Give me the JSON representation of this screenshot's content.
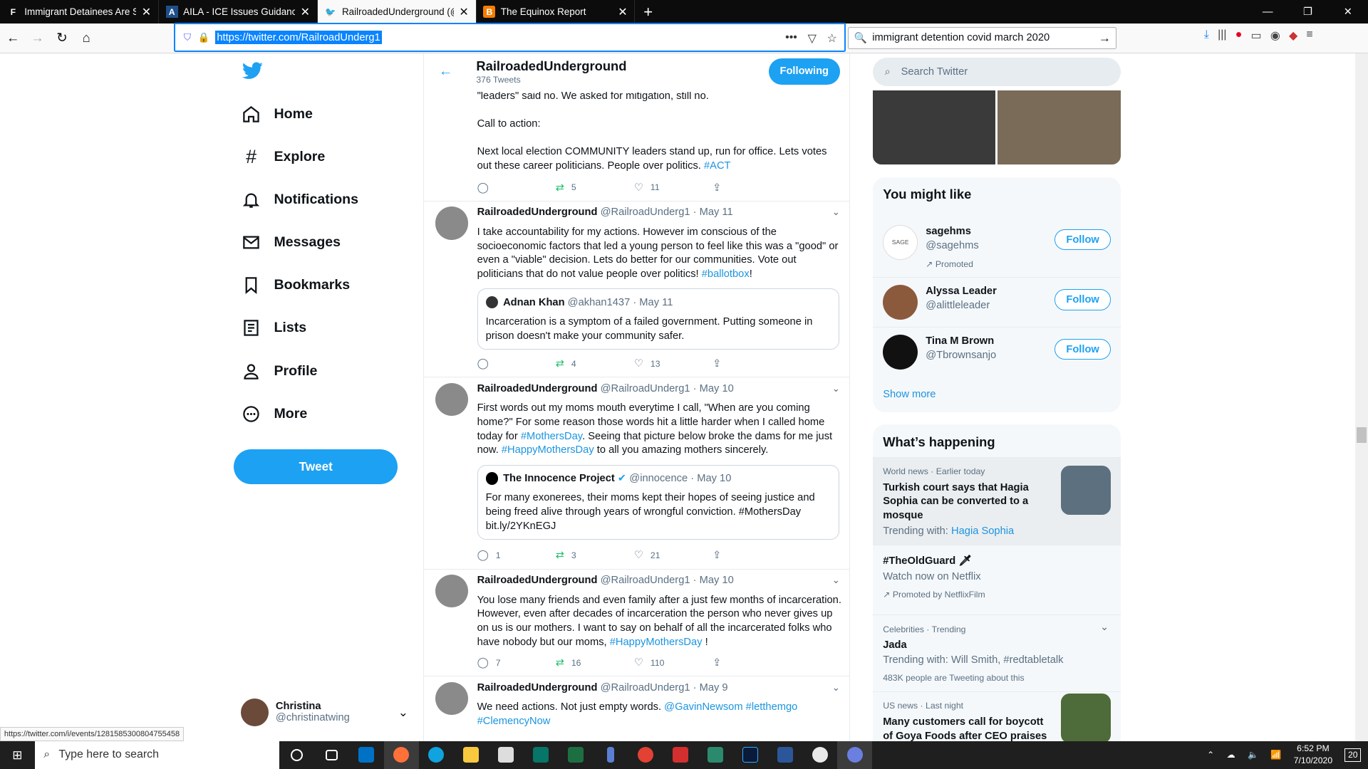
{
  "browser": {
    "tabs": [
      {
        "favicon": "F",
        "title": "Immigrant Detainees Are Sitting",
        "active": false
      },
      {
        "favicon": "A",
        "title": "AILA - ICE Issues Guidance on C",
        "active": false
      },
      {
        "favicon": "t",
        "title": "RailroadedUnderground (@Rail",
        "active": true
      },
      {
        "favicon": "B",
        "title": "The Equinox Report",
        "active": false
      }
    ],
    "new_tab": "+",
    "url": "https://twitter.com/RailroadUnderg1",
    "search_value": "immigrant detention covid march 2020",
    "status_url": "https://twitter.com/i/events/1281585300804755458"
  },
  "leftnav": {
    "items": [
      "Home",
      "Explore",
      "Notifications",
      "Messages",
      "Bookmarks",
      "Lists",
      "Profile",
      "More"
    ],
    "tweet_button": "Tweet",
    "account_name": "Christina",
    "account_handle": "@christinatwing"
  },
  "profile": {
    "name": "RailroadedUnderground",
    "tweet_count": "376 Tweets",
    "following_button": "Following"
  },
  "tweets": [
    {
      "lines": [
        "\"leaders\" said no. We asked for mitigation, still no.",
        "Call to action:",
        "Next local election COMMUNITY leaders stand up, run for office. Lets votes out these career politicians. People over politics."
      ],
      "tag": "#ACT",
      "replies": "",
      "retweets": "5",
      "likes": "11"
    },
    {
      "name": "RailroadedUnderground",
      "handle": "@RailroadUnderg1",
      "date": "· May 11",
      "text": "I take accountability for my actions. However im conscious of the socioeconomic factors that led a young person to feel like this was a \"good\" or even a \"viable\" decision. Lets do better for our communities. Vote out politicians that do not value people over politics!",
      "tag": "#ballotbox",
      "tail": "!",
      "quote_name": "Adnan Khan",
      "quote_handle": "@akhan1437 · May 11",
      "quote_text": "Incarceration is a symptom of a failed government. Putting someone in prison doesn't make your community safer.",
      "replies": "",
      "retweets": "4",
      "likes": "13"
    },
    {
      "name": "RailroadedUnderground",
      "handle": "@RailroadUnderg1",
      "date": "· May 10",
      "text_a": "First words out my moms mouth everytime I call, \"When are you coming home?\" For some reason those words hit a little harder when I called home today for",
      "tag_a": "#MothersDay",
      "text_b": ". Seeing that picture below broke the dams for me just now.",
      "tag_b": "#HappyMothersDay",
      "text_c": "to all you amazing mothers sincerely.",
      "quote_name": "The Innocence Project",
      "quote_handle": "@innocence · May 10",
      "quote_text": "For many exonerees, their moms kept their hopes of seeing justice and being freed alive through years of wrongful conviction. #MothersDay bit.ly/2YKnEGJ",
      "replies": "1",
      "retweets": "3",
      "likes": "21"
    },
    {
      "name": "RailroadedUnderground",
      "handle": "@RailroadUnderg1",
      "date": "· May 10",
      "text": "You lose many friends and even family after a just few months of incarceration. However, even after decades of incarceration the person who never gives up on us is our mothers. I want to say on behalf of all the incarcerated folks who have nobody but our moms,",
      "tag": "#HappyMothersDay",
      "tail": "!",
      "replies": "7",
      "retweets": "16",
      "likes": "110"
    },
    {
      "name": "RailroadedUnderground",
      "handle": "@RailroadUnderg1",
      "date": "· May 9",
      "text": "We need actions. Not just empty words.",
      "tag": "@GavinNewsom #letthemgo #ClemencyNow"
    }
  ],
  "right": {
    "search_placeholder": "Search Twitter",
    "might_like_title": "You might like",
    "people": [
      {
        "name": "sagehms",
        "handle": "@sagehms",
        "promoted": "Promoted",
        "button": "Follow"
      },
      {
        "name": "Alyssa Leader",
        "handle": "@alittleleader",
        "button": "Follow"
      },
      {
        "name": "Tina M Brown",
        "handle": "@Tbrownsanjo",
        "button": "Follow"
      }
    ],
    "show_more": "Show more",
    "happening_title": "What’s happening",
    "trends": [
      {
        "meta": "World news · Earlier today",
        "title": "Turkish court says that Hagia Sophia can be converted to a mosque",
        "sub_label": "Trending with:",
        "sub_link": "Hagia Sophia"
      },
      {
        "title": "#TheOldGuard",
        "sub": "Watch now on Netflix",
        "meta2": "Promoted by NetflixFilm"
      },
      {
        "meta": "Celebrities · Trending",
        "title": "Jada",
        "sub": "Trending with: Will Smith, #redtabletalk",
        "meta2": "483K people are Tweeting about this"
      },
      {
        "meta": "US news · Last night",
        "title": "Many customers call for boycott of Goya Foods after CEO praises"
      }
    ]
  },
  "taskbar": {
    "search_placeholder": "Type here to search",
    "time": "6:52 PM",
    "date": "7/10/2020",
    "notifications": "20"
  }
}
